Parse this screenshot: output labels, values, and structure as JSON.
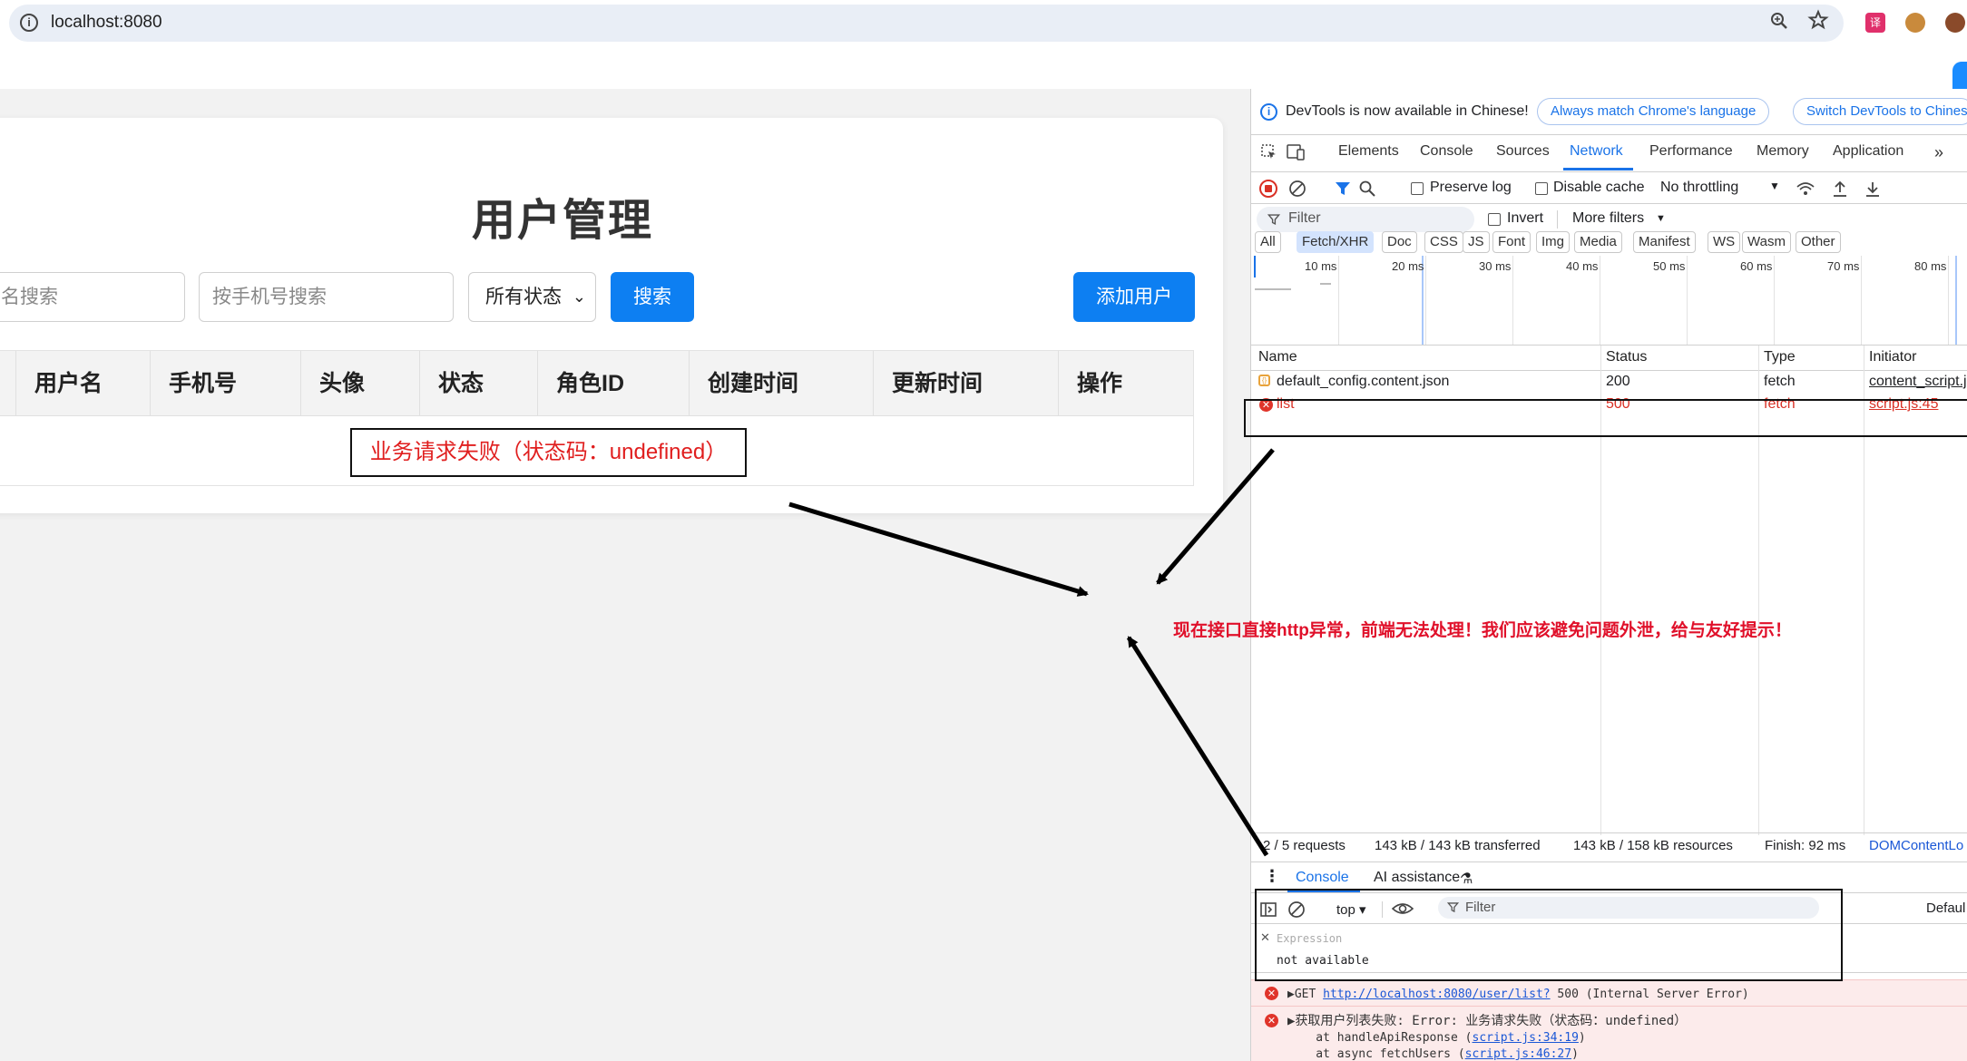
{
  "browser": {
    "url": "localhost:8080",
    "icons": [
      "site-info-icon",
      "zoom-icon",
      "star-icon",
      "translate-extension-icon",
      "cookie-extension-icon",
      "cookie-extension-2-icon"
    ]
  },
  "page": {
    "title": "用户管理",
    "username_search_placeholder": "名搜索",
    "phone_search_placeholder": "按手机号搜索",
    "status_select": "所有状态",
    "search_button": "搜索",
    "add_user_button": "添加用户",
    "table_headers": [
      "用户名",
      "手机号",
      "头像",
      "状态",
      "角色ID",
      "创建时间",
      "更新时间",
      "操作"
    ],
    "error_message": "业务请求失败（状态码：undefined）"
  },
  "devtools": {
    "banner_text": "DevTools is now available in Chinese!",
    "banner_btn1": "Always match Chrome's language",
    "banner_btn2": "Switch DevTools to Chinese",
    "tabs": [
      "Elements",
      "Console",
      "Sources",
      "Network",
      "Performance",
      "Memory",
      "Application"
    ],
    "active_tab": "Network",
    "preserve_log": "Preserve log",
    "disable_cache": "Disable cache",
    "throttling": "No throttling",
    "filter_placeholder": "Filter",
    "invert": "Invert",
    "more_filters": "More filters",
    "type_filters": [
      "All",
      "Fetch/XHR",
      "Doc",
      "CSS",
      "JS",
      "Font",
      "Img",
      "Media",
      "Manifest",
      "WS",
      "Wasm",
      "Other"
    ],
    "timeline_ticks": [
      "10 ms",
      "20 ms",
      "30 ms",
      "40 ms",
      "50 ms",
      "60 ms",
      "70 ms",
      "80 ms"
    ],
    "columns": [
      "Name",
      "Status",
      "Type",
      "Initiator"
    ],
    "requests": [
      {
        "name": "default_config.content.json",
        "status": "200",
        "type": "fetch",
        "initiator": "content_script.j"
      },
      {
        "name": "list",
        "status": "500",
        "type": "fetch",
        "initiator": "script.js:45"
      }
    ],
    "summary": {
      "requests": "2 / 5 requests",
      "transferred": "143 kB / 143 kB transferred",
      "resources": "143 kB / 158 kB resources",
      "finish": "Finish: 92 ms",
      "dcl": "DOMContentLo"
    },
    "drawer_tabs": [
      "Console",
      "AI assistance"
    ],
    "console_context": "top",
    "console_filter": "Filter",
    "console_levels": "Defaul",
    "expression_label": "Expression",
    "expression_value": "not available",
    "console_errors": [
      {
        "prefix": "GET ",
        "link": "http://localhost:8080/user/list?",
        "suffix": " 500 (Internal Server Error)"
      },
      {
        "text": "获取用户列表失败: Error: 业务请求失败（状态码：undefined）",
        "trace1_pre": "    at handleApiResponse (",
        "trace1_link": "script.js:34:19",
        "trace1_post": ")",
        "trace2_pre": "    at async fetchUsers (",
        "trace2_link": "script.js:46:27",
        "trace2_post": ")"
      }
    ]
  },
  "annotation": "现在接口直接http异常，前端无法处理！我们应该避免问题外泄，给与友好提示！",
  "colors": {
    "primary": "#0d7ff2",
    "error": "#e01e1e",
    "devtools_blue": "#1a73e8"
  }
}
